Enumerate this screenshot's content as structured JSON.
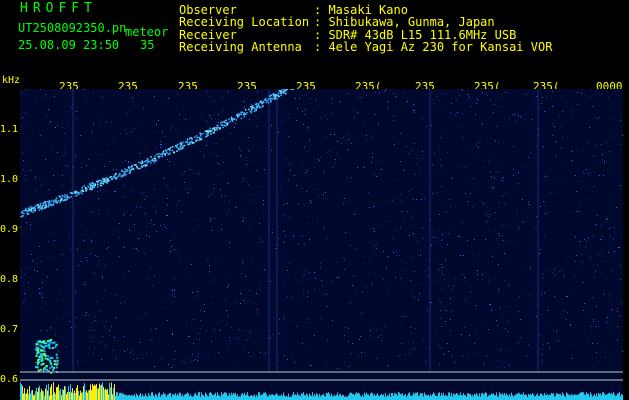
{
  "header": {
    "title": "HROFFT",
    "filename": "UT2508092350.pn",
    "tag": "meteor",
    "datetime": "25.08.09 23:50",
    "count": "35"
  },
  "station": {
    "rows": [
      {
        "label": "Observer",
        "value": ": Masaki Kano"
      },
      {
        "label": "Receiving Location",
        "value": ": Shibukawa, Gunma, Japan"
      },
      {
        "label": "Receiver",
        "value": ": SDR# 43dB L15 111.6MHz USB"
      },
      {
        "label": "Receiving Antenna",
        "value": ": 4ele Yagi Az 230 for Kansai VOR"
      }
    ]
  },
  "axis": {
    "unit": "kHz",
    "y_ticks": [
      "1.1",
      "1.0",
      "0.9",
      "0.8",
      "0.7",
      "0.6"
    ],
    "x_ticks": [
      "235",
      "235",
      "235",
      "235",
      "235",
      "235(",
      "235",
      "235(",
      "235(",
      "0000"
    ]
  },
  "colors": {
    "background": "#00082e",
    "signal": "#33aaff",
    "header_green": "#00ff00",
    "header_yellow": "#ffff00"
  }
}
